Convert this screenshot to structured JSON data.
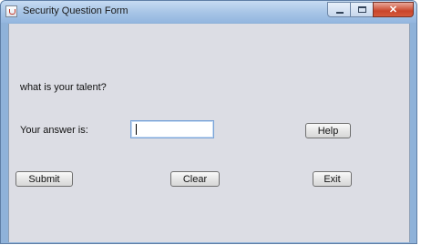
{
  "window": {
    "title": "Security Question Form"
  },
  "form": {
    "question": "what is your talent?",
    "answer_label": "Your answer is:",
    "answer_value": "",
    "help_label": "Help",
    "submit_label": "Submit",
    "clear_label": "Clear",
    "exit_label": "Exit"
  },
  "icons": {
    "app": "java-cup-icon",
    "minimize": "minimize-icon",
    "maximize": "maximize-icon",
    "close": "close-icon"
  }
}
